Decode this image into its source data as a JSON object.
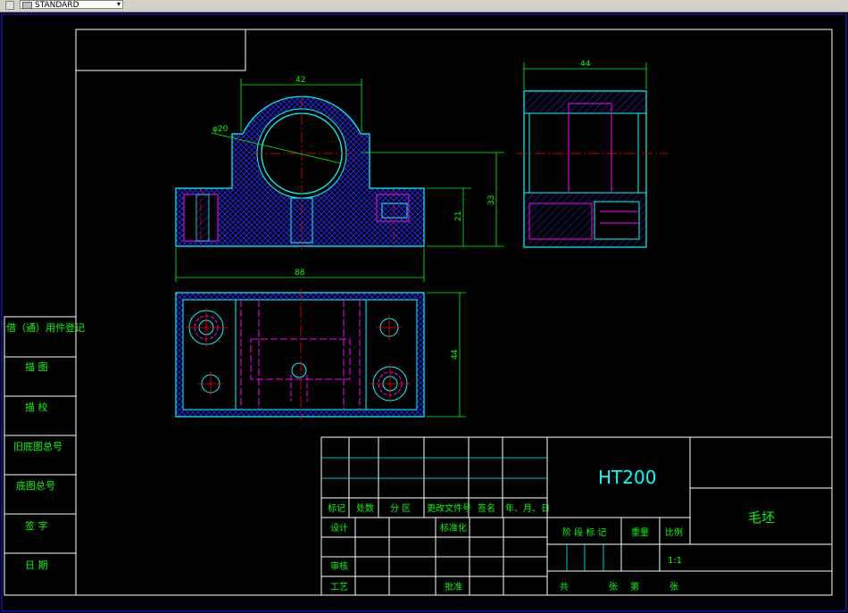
{
  "toolbar": {
    "style_combo": "STANDARD"
  },
  "views": {
    "front": {
      "dim_width_top": "42",
      "dim_hole": "φ20",
      "dim_total_width": "88",
      "dim_h1": "21",
      "dim_h2": "33"
    },
    "side": {
      "dim_width": "44"
    },
    "top": {
      "dim_height": "44"
    }
  },
  "side_box": {
    "items": [
      "借（通）用件登记",
      "描  图",
      "描  校",
      "旧底图总号",
      "底图总号",
      "签  字",
      "日  期"
    ]
  },
  "title_block": {
    "material": "HT200",
    "name": "毛坯",
    "rev_headers": [
      "标记",
      "处数",
      "分 区",
      "更改文件号",
      "签名",
      "年、月、日"
    ],
    "design": "设计",
    "standardize": "标准化",
    "review": "审核",
    "process": "工艺",
    "approve": "批准",
    "stage_mark": "阶 段 标 记",
    "weight": "重量",
    "scale": "比例",
    "scale_value": "1:1",
    "total": "共",
    "sheet_word": "张",
    "page_word": "第",
    "page_word2": "张"
  },
  "colors": {
    "frame": "#ffffff",
    "outline": "#00ffff",
    "hidden": "#ff00ff",
    "center": "#ff0000",
    "dim": "#00ff00",
    "hatch": "#0000ff"
  }
}
